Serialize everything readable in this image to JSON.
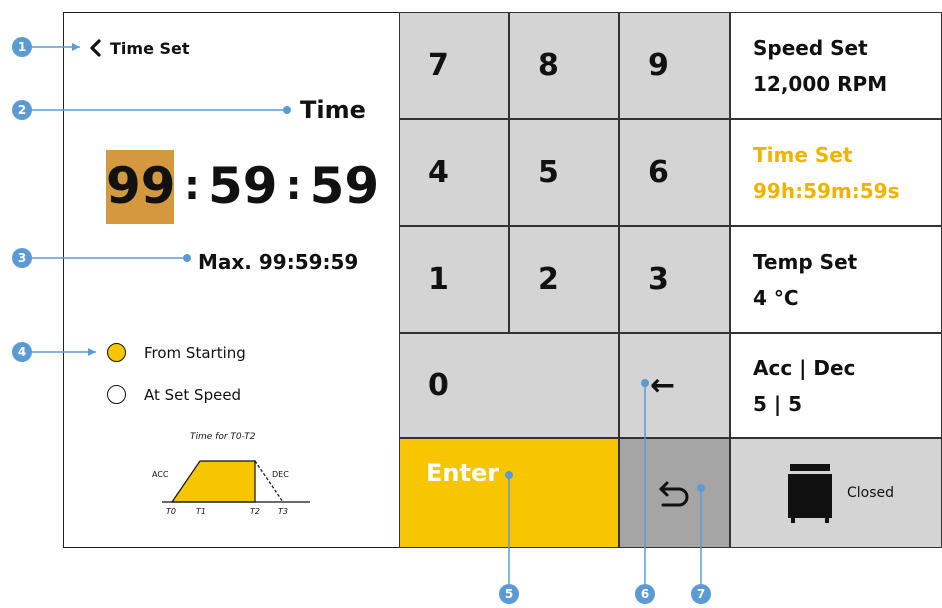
{
  "header": {
    "back_label": "Time Set"
  },
  "time_panel": {
    "title": "Time",
    "hours": "99",
    "sep1": ":",
    "minutes": "59",
    "sep2": ":",
    "seconds": "59",
    "max_label": "Max. 99:59:59"
  },
  "options": [
    {
      "label": "From Starting",
      "selected": true
    },
    {
      "label": "At Set Speed",
      "selected": false
    }
  ],
  "diagram": {
    "title": "Time for T0-T2",
    "acc": "ACC",
    "dec": "DEC",
    "t0": "T0",
    "t1": "T1",
    "t2": "T2",
    "t3": "T3"
  },
  "keypad": {
    "k7": "7",
    "k8": "8",
    "k9": "9",
    "k4": "4",
    "k5": "5",
    "k6": "6",
    "k1": "1",
    "k2": "2",
    "k3": "3",
    "k0": "0",
    "backspace": "←",
    "enter": "Enter",
    "undo_icon": "undo-icon"
  },
  "settings": {
    "speed": {
      "title": "Speed Set",
      "value": "12,000 RPM"
    },
    "time": {
      "title": "Time Set",
      "value": "99h:59m:59s"
    },
    "temp": {
      "title": "Temp Set",
      "value": "4 °C"
    },
    "accdec": {
      "title": "Acc | Dec",
      "value": "5 | 5"
    },
    "lid": {
      "label": "Closed",
      "icon": "lid-closed-icon"
    }
  },
  "callouts": {
    "c1": "1",
    "c2": "2",
    "c3": "3",
    "c4": "4",
    "c5": "5",
    "c6": "6",
    "c7": "7"
  },
  "colors": {
    "accent": "#f7c600",
    "active_text": "#f2b300",
    "hour_highlight": "#d4993e",
    "callout": "#5b9bd5",
    "key_bg": "#d4d4d4"
  }
}
